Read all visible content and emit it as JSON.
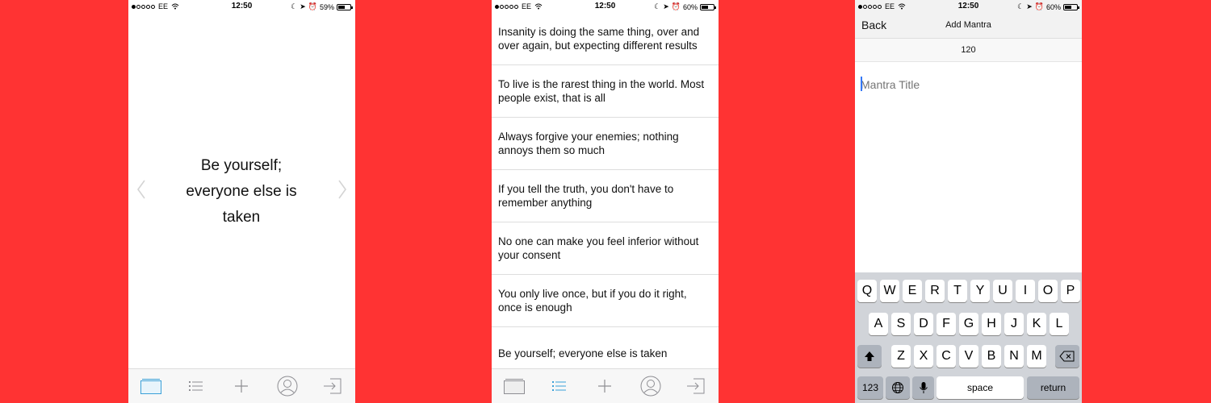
{
  "status": {
    "carrier": "EE",
    "time": "12:50",
    "phone1_battery": "59%",
    "phone2_battery": "60%",
    "phone3_battery": "60%"
  },
  "phone1": {
    "quote_line1": "Be yourself;",
    "quote_line2": "everyone else is",
    "quote_line3": "taken"
  },
  "phone2": {
    "items": [
      {
        "label": "Insanity is doing the same thing, over and over again, but expecting different results"
      },
      {
        "label": "To live is the rarest thing in the world. Most people exist, that is all"
      },
      {
        "label": "Always forgive your enemies; nothing annoys them so much"
      },
      {
        "label": "If you tell the truth, you don't have to remember anything"
      },
      {
        "label": "No one can make you feel inferior without your consent"
      },
      {
        "label": "You only live once, but if you do it right, once is enough"
      },
      {
        "label": "Be yourself; everyone else is taken"
      }
    ]
  },
  "phone3": {
    "back_label": "Back",
    "title": "Add Mantra",
    "counter": "120",
    "input_placeholder": "Mantra Title",
    "keys": {
      "row1": [
        "Q",
        "W",
        "E",
        "R",
        "T",
        "Y",
        "U",
        "I",
        "O",
        "P"
      ],
      "row2": [
        "A",
        "S",
        "D",
        "F",
        "G",
        "H",
        "J",
        "K",
        "L"
      ],
      "row3": [
        "Z",
        "X",
        "C",
        "V",
        "B",
        "N",
        "M"
      ],
      "num_label": "123",
      "space_label": "space",
      "return_label": "return"
    }
  },
  "colors": {
    "background": "#ff3333",
    "tab_active": "#3aa0d8",
    "tab_inactive": "#8e8e93"
  },
  "icons": {
    "tab_cards": "cards-icon",
    "tab_list": "list-icon",
    "tab_add": "plus-icon",
    "tab_profile": "profile-icon",
    "tab_logout": "logout-icon"
  }
}
